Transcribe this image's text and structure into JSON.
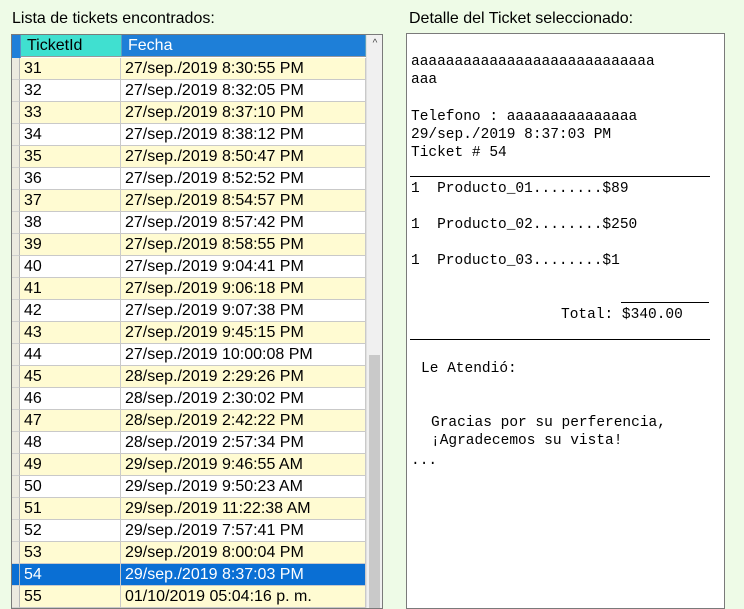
{
  "labels": {
    "list_title": "Lista de tickets encontrados:",
    "detail_title": "Detalle del Ticket seleccionado:"
  },
  "grid": {
    "columns": [
      "TicketId",
      "Fecha"
    ],
    "rows": [
      [
        "31",
        "27/sep./2019 8:30:55 PM"
      ],
      [
        "32",
        "27/sep./2019 8:32:05 PM"
      ],
      [
        "33",
        "27/sep./2019 8:37:10 PM"
      ],
      [
        "34",
        "27/sep./2019 8:38:12 PM"
      ],
      [
        "35",
        "27/sep./2019 8:50:47 PM"
      ],
      [
        "36",
        "27/sep./2019 8:52:52 PM"
      ],
      [
        "37",
        "27/sep./2019 8:54:57 PM"
      ],
      [
        "38",
        "27/sep./2019 8:57:42 PM"
      ],
      [
        "39",
        "27/sep./2019 8:58:55 PM"
      ],
      [
        "40",
        "27/sep./2019 9:04:41 PM"
      ],
      [
        "41",
        "27/sep./2019 9:06:18 PM"
      ],
      [
        "42",
        "27/sep./2019 9:07:38 PM"
      ],
      [
        "43",
        "27/sep./2019 9:45:15 PM"
      ],
      [
        "44",
        "27/sep./2019 10:00:08 PM"
      ],
      [
        "45",
        "28/sep./2019 2:29:26 PM"
      ],
      [
        "46",
        "28/sep./2019 2:30:02 PM"
      ],
      [
        "47",
        "28/sep./2019 2:42:22 PM"
      ],
      [
        "48",
        "28/sep./2019 2:57:34 PM"
      ],
      [
        "49",
        "29/sep./2019 9:46:55 AM"
      ],
      [
        "50",
        "29/sep./2019 9:50:23 AM"
      ],
      [
        "51",
        "29/sep./2019 11:22:38 AM"
      ],
      [
        "52",
        "29/sep./2019 7:57:41 PM"
      ],
      [
        "53",
        "29/sep./2019 8:00:04 PM"
      ],
      [
        "54",
        "29/sep./2019 8:37:03 PM"
      ],
      [
        "55",
        "01/10/2019 05:04:16 p. m."
      ]
    ],
    "selected_id": "54",
    "scroll_up_glyph": "^"
  },
  "ticket": {
    "line1": "aaaaaaaaaaaaaaaaaaaaaaaaaaaa",
    "line2": "aaa",
    "phone": "Telefono : aaaaaaaaaaaaaaa",
    "date": "29/sep./2019 8:37:03 PM",
    "number": "Ticket # 54",
    "items": [
      "1  Producto_01........$89",
      "1  Producto_02........$250",
      "1  Producto_03........$1"
    ],
    "total": "Total: $340.00",
    "attended": "Le Atendió:",
    "thanks1": "Gracias por su perferencia,",
    "thanks2": "¡Agradecemos su vista!",
    "ellipsis": "..."
  }
}
